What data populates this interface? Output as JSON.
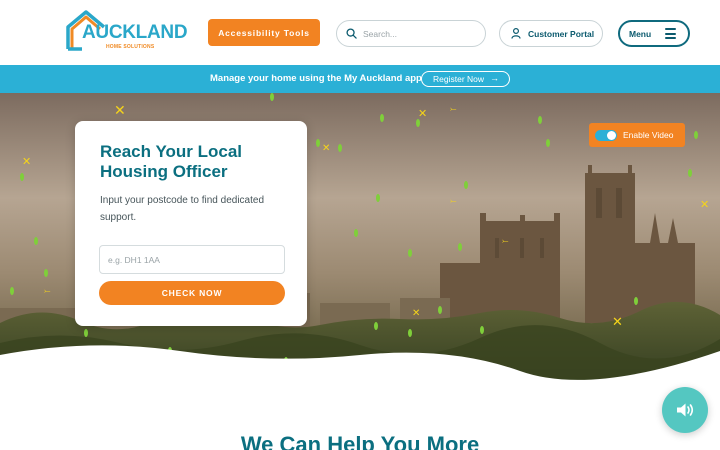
{
  "brand": {
    "name": "AUCKLAND",
    "tagline": "HOME SOLUTIONS"
  },
  "header": {
    "accessibility_label": "Accessibility Tools",
    "search_placeholder": "Search...",
    "portal_label": "Customer Portal",
    "menu_label": "Menu"
  },
  "banner": {
    "text": "Manage your home using the My Auckland app",
    "button_label": "Register Now"
  },
  "hero": {
    "card": {
      "title": "Reach Your Local Housing Officer",
      "text": "Input your postcode to find dedicated support.",
      "input_placeholder": "e.g. DH1 1AA",
      "button_label": "CHECK NOW"
    },
    "video_label": "Enable Video"
  },
  "section": {
    "heading": "We Can Help You More"
  },
  "colors": {
    "brand_teal": "#0b6f80",
    "brand_orange": "#f28322",
    "banner_blue": "#2bb0d6",
    "audio_teal": "#54c7c1"
  },
  "icons": [
    "house-logo-icon",
    "search-icon",
    "user-icon",
    "hamburger-icon",
    "arrow-right-icon",
    "toggle-icon",
    "speaker-icon"
  ]
}
